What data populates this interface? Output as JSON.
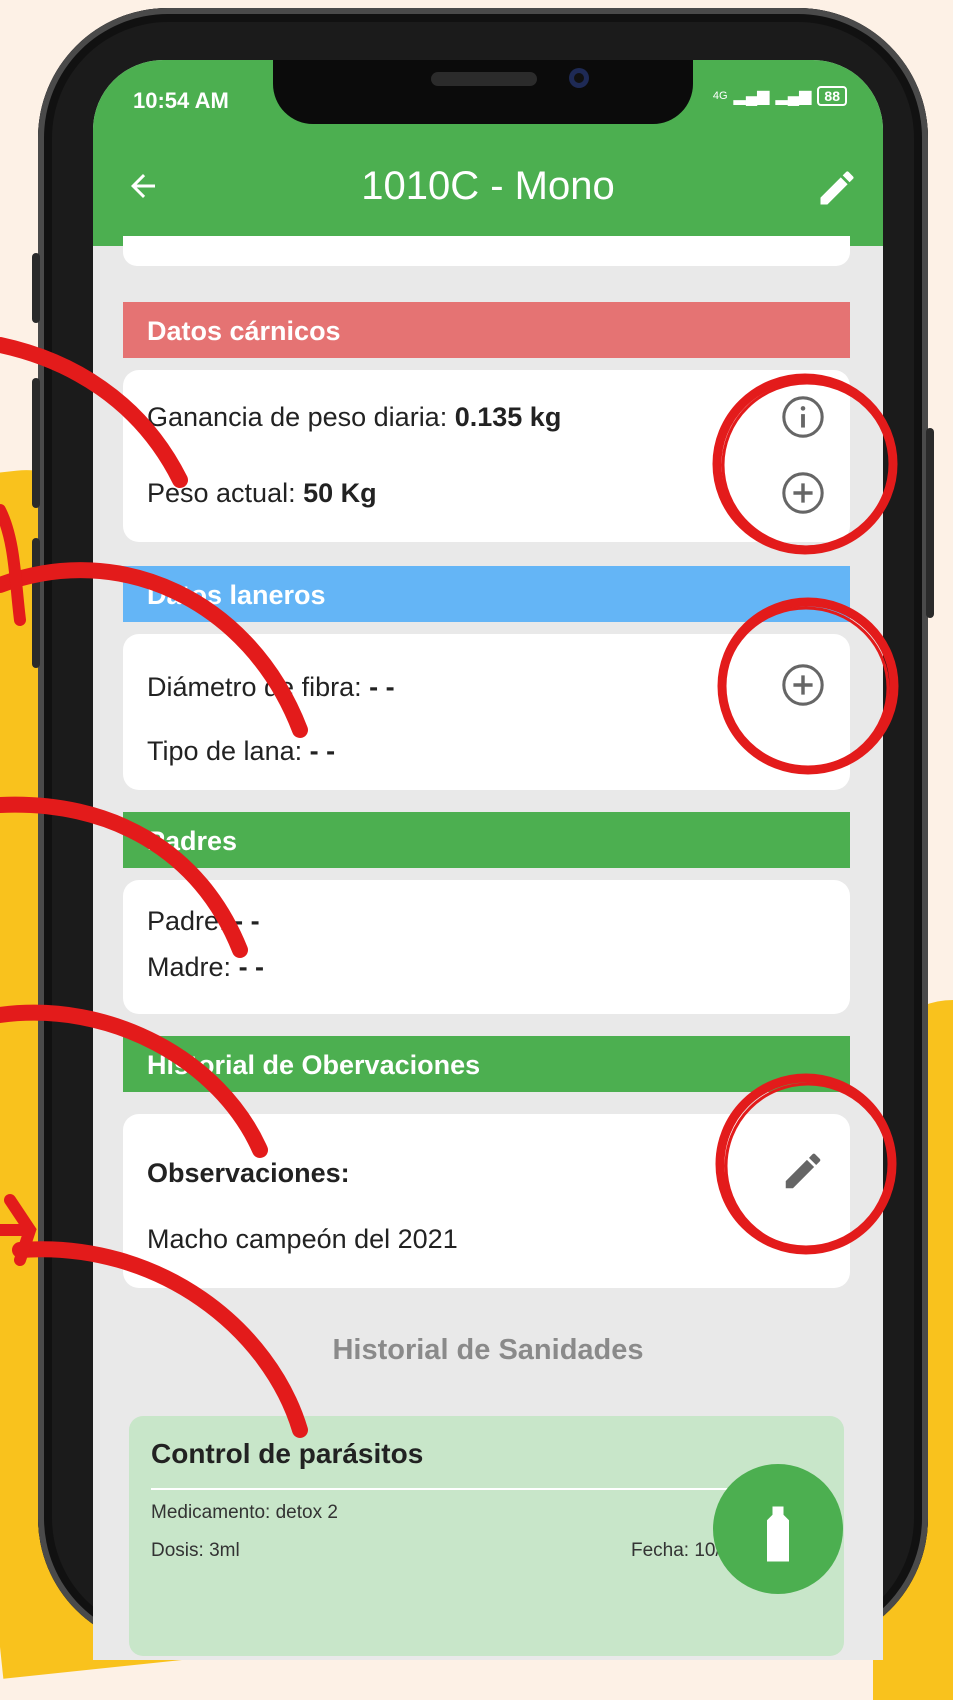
{
  "status_bar": {
    "time": "10:54 AM",
    "network": "4G",
    "battery": "88"
  },
  "app_bar": {
    "title": "1010C - Mono",
    "back_icon": "arrow-left-icon",
    "edit_icon": "pencil-icon"
  },
  "sections": {
    "carnicos": {
      "header": "Datos cárnicos",
      "header_color": "#e57373",
      "ganancia_label": "Ganancia de peso diaria:",
      "ganancia_value": "0.135 kg",
      "peso_label": "Peso actual:",
      "peso_value": "50 Kg"
    },
    "laneros": {
      "header": "Datos laneros",
      "header_color": "#64b5f6",
      "diametro_label": "Diámetro de fibra:",
      "diametro_value": "- -",
      "tipo_label": "Tipo de lana:",
      "tipo_value": "- -"
    },
    "padres": {
      "header": "Padres",
      "header_color": "#4caf50",
      "padre_label": "Padre:",
      "padre_value": "- -",
      "madre_label": "Madre:",
      "madre_value": "- -"
    },
    "observaciones": {
      "header": "Historial de Obervaciones",
      "header_color": "#4caf50",
      "label": "Observaciones:",
      "text": "Macho campeón del 2021"
    }
  },
  "sanidades": {
    "title": "Historial de Sanidades",
    "card": {
      "title": "Control de parásitos",
      "medicamento": "Medicamento: detox 2",
      "dosis": "Dosis: 3ml",
      "fecha": "Fecha: 10/"
    }
  },
  "colors": {
    "primary": "#4caf50",
    "annotation": "#e31b1b",
    "background_accent": "#f9c21d"
  }
}
